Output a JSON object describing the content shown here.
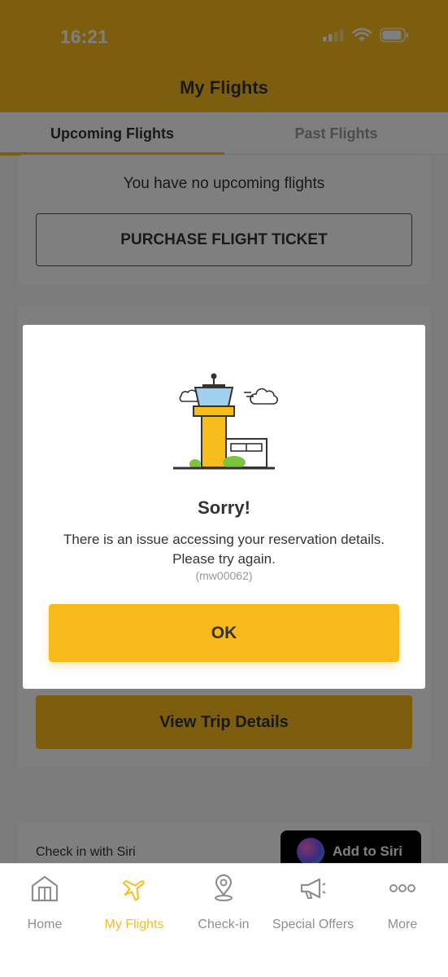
{
  "status_bar": {
    "time": "16:21"
  },
  "header": {
    "title": "My Flights"
  },
  "tabs": [
    {
      "label": "Upcoming Flights",
      "active": true
    },
    {
      "label": "Past Flights",
      "active": false
    }
  ],
  "upcoming": {
    "empty_message": "You have no upcoming flights",
    "purchase_label": "PURCHASE FLIGHT TICKET"
  },
  "trip_card": {
    "view_details_label": "View Trip Details"
  },
  "siri": {
    "label": "Check in with Siri",
    "button_label": "Add to Siri"
  },
  "modal": {
    "title": "Sorry!",
    "message_line1": "There is an issue accessing your reservation details.",
    "message_line2": "Please try again.",
    "code": "(mw00062)",
    "ok_label": "OK"
  },
  "tabbar": {
    "items": [
      {
        "label": "Home",
        "icon": "home-icon",
        "active": false
      },
      {
        "label": "My Flights",
        "icon": "plane-icon",
        "active": true
      },
      {
        "label": "Check-in",
        "icon": "location-pin-icon",
        "active": false
      },
      {
        "label": "Special Offers",
        "icon": "megaphone-icon",
        "active": false
      },
      {
        "label": "More",
        "icon": "more-dots-icon",
        "active": false
      }
    ]
  },
  "colors": {
    "brand": "#f8bd1c",
    "ok_button": "#f8b91a",
    "text": "#333333",
    "inactive": "#8e8e8e"
  }
}
